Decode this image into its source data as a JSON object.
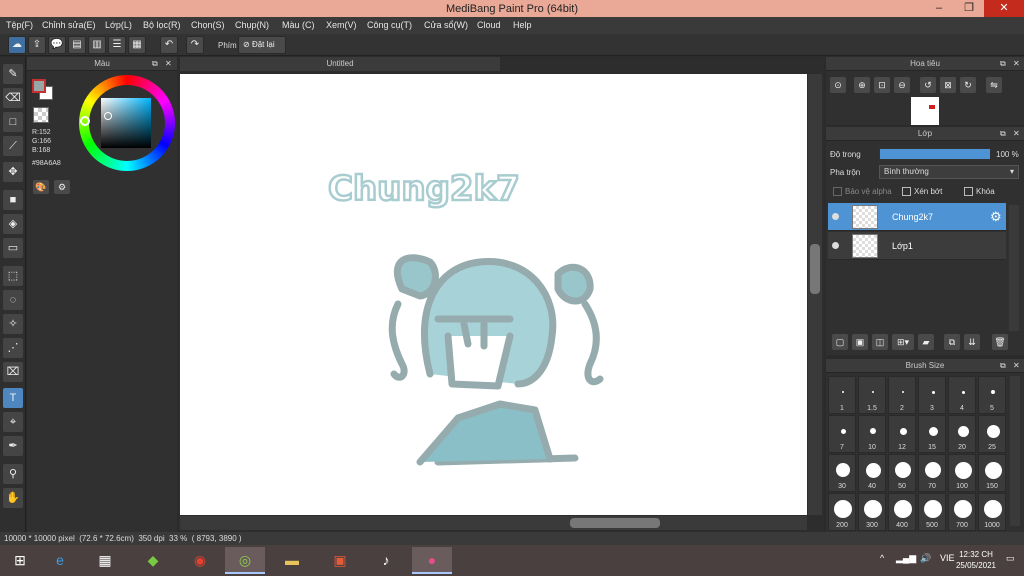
{
  "window": {
    "title": "MediBang Paint Pro (64bit)",
    "min": "–",
    "max": "❐",
    "close": "✕"
  },
  "menu": [
    "Tệp(F)",
    "Chỉnh sửa(E)",
    "Lớp(L)",
    "Bộ lọc(R)",
    "Chọn(S)",
    "Chụp(N)",
    "Màu (C)",
    "Xem(V)",
    "Công cụ(T)",
    "Cửa sổ(W)",
    "Cloud",
    "Help"
  ],
  "toolbar": {
    "key_label": "Phím",
    "reset_label": "Đặt lại"
  },
  "color_panel": {
    "title": "Màu",
    "fg_color": "#98A6A8",
    "r": "R:152",
    "g": "G:166",
    "b": "B:168",
    "hex": "#98A6A8"
  },
  "document": {
    "tab": "Untitled",
    "text_on_canvas": "Chung2k7"
  },
  "navigator": {
    "title": "Hoa tiêu"
  },
  "layer_panel": {
    "title": "Lớp",
    "opacity_label": "Độ trong",
    "opacity_value": "100 %",
    "opacity_fraction": 1.0,
    "blend_label": "Pha trộn",
    "blend_value": "Bình thường",
    "protect_alpha": "Bảo vệ alpha",
    "clipping": "Xén bớt",
    "lock": "Khóa",
    "layers": [
      {
        "name": "Chung2k7",
        "selected": true
      },
      {
        "name": "Lớp1",
        "selected": false
      }
    ]
  },
  "brush_size": {
    "title": "Brush Size",
    "sizes": [
      "1",
      "1.5",
      "2",
      "3",
      "4",
      "5",
      "7",
      "10",
      "12",
      "15",
      "20",
      "25",
      "30",
      "40",
      "50",
      "70",
      "100",
      "150",
      "200",
      "300",
      "400",
      "500",
      "700",
      "1000"
    ]
  },
  "status": {
    "size": "10000 * 10000 pixel",
    "physical": "(72.6 * 72.6cm)",
    "dpi": "350 dpi",
    "zoom": "33 %",
    "coords": "( 8793, 3890 )"
  },
  "taskbar": {
    "lang": "VIE",
    "time": "12:32 CH",
    "date": "25/05/2021"
  },
  "accent": "#4e94d4"
}
